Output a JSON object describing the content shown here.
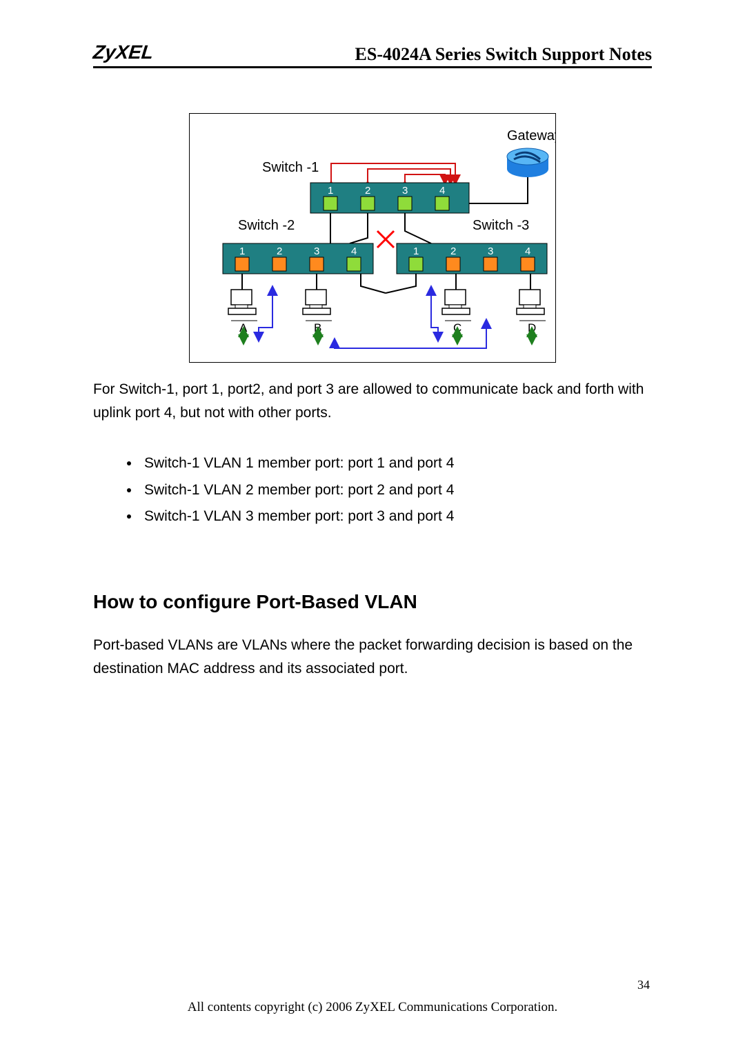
{
  "header": {
    "logo": "ZyXEL",
    "title": "ES-4024A Series Switch Support Notes"
  },
  "diagram": {
    "gateway_label": "Gateway",
    "switch1": {
      "label": "Switch -1",
      "ports": [
        "1",
        "2",
        "3",
        "4"
      ]
    },
    "switch2": {
      "label": "Switch -2",
      "ports": [
        "1",
        "2",
        "3",
        "4"
      ]
    },
    "switch3": {
      "label": "Switch -3",
      "ports": [
        "1",
        "2",
        "3",
        "4"
      ]
    },
    "hosts": {
      "A": "A",
      "B": "B",
      "C": "C",
      "D": "D"
    }
  },
  "body": {
    "para1": "For Switch-1, port 1, port2, and port 3 are allowed to communicate back and forth with uplink port 4, but not with other ports.",
    "list": [
      "Switch-1 VLAN 1 member port: port 1 and port 4",
      "Switch-1 VLAN 2 member port: port 2 and port 4",
      "Switch-1 VLAN 3 member port: port 3 and port 4"
    ],
    "section_heading": "How to configure Port-Based VLAN",
    "para2": "Port-based VLANs are VLANs where the packet forwarding decision is based on the destination MAC address and its associated port."
  },
  "footer": {
    "page_number": "34",
    "copyright": "All contents copyright (c) 2006 ZyXEL Communications Corporation."
  },
  "colors": {
    "switch_body": "#1f7f82",
    "port_lime": "#8fdc3a",
    "port_orange": "#ff8a1e",
    "gateway_blue": "#1f7fe0",
    "gateway_top": "#58b6f5",
    "wire_red": "#d11212",
    "wire_blue": "#2a2ae0",
    "cross_red": "#ff0000"
  }
}
